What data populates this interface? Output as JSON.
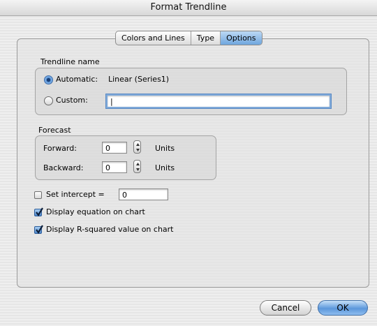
{
  "window": {
    "title": "Format Trendline"
  },
  "tabs": [
    {
      "label": "Colors and Lines",
      "active": false
    },
    {
      "label": "Type",
      "active": false
    },
    {
      "label": "Options",
      "active": true
    }
  ],
  "trendline_name": {
    "label": "Trendline name",
    "automatic_label": "Automatic:",
    "automatic_value": "Linear (Series1)",
    "automatic_selected": true,
    "custom_label": "Custom:",
    "custom_value": "|"
  },
  "forecast": {
    "label": "Forecast",
    "forward_label": "Forward:",
    "forward_value": "0",
    "backward_label": "Backward:",
    "backward_value": "0",
    "units": "Units"
  },
  "options": {
    "intercept_label": "Set intercept =",
    "intercept_value": "0",
    "intercept_checked": false,
    "equation_label": "Display equation on chart",
    "equation_checked": true,
    "rsquared_label": "Display R-squared value on chart",
    "rsquared_checked": true
  },
  "buttons": {
    "cancel": "Cancel",
    "ok": "OK"
  },
  "colors": {
    "accent": "#5b97db",
    "tab_active": "#6fa6de"
  }
}
